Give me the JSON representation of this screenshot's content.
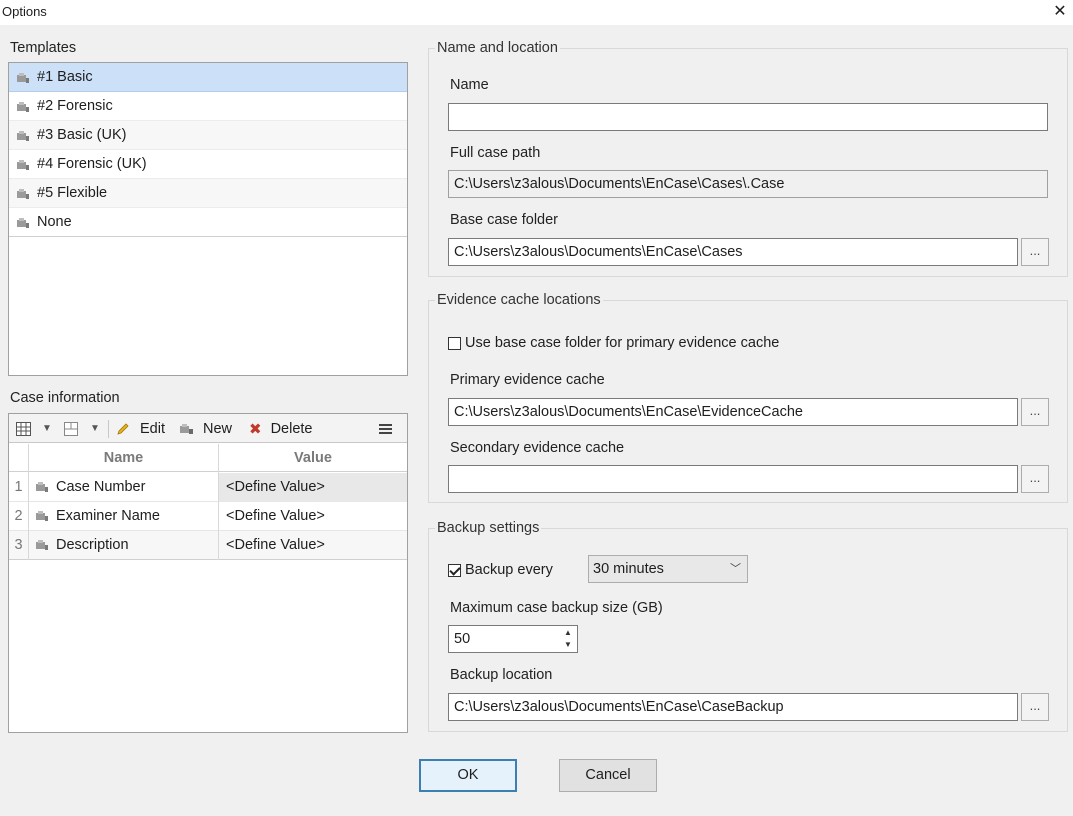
{
  "window": {
    "title": "Options",
    "close_icon": "✕"
  },
  "templates": {
    "label": "Templates",
    "items": [
      {
        "label": "#1 Basic",
        "selected": true
      },
      {
        "label": "#2 Forensic",
        "selected": false
      },
      {
        "label": "#3 Basic (UK)",
        "selected": false
      },
      {
        "label": "#4 Forensic (UK)",
        "selected": false
      },
      {
        "label": "#5 Flexible",
        "selected": false
      },
      {
        "label": "None",
        "selected": false
      }
    ]
  },
  "case_information": {
    "label": "Case information",
    "toolbar": {
      "edit_label": "Edit",
      "new_label": "New",
      "delete_label": "Delete"
    },
    "columns": [
      "Name",
      "Value"
    ],
    "rows": [
      {
        "num": "1",
        "name": "Case Number",
        "value": "<Define Value>"
      },
      {
        "num": "2",
        "name": "Examiner Name",
        "value": "<Define Value>"
      },
      {
        "num": "3",
        "name": "Description",
        "value": "<Define Value>"
      }
    ]
  },
  "name_and_location": {
    "title": "Name and location",
    "name_label": "Name",
    "name_value": "",
    "full_path_label": "Full case path",
    "full_path_value": "C:\\Users\\z3alous\\Documents\\EnCase\\Cases\\.Case",
    "base_folder_label": "Base case folder",
    "base_folder_value": "C:\\Users\\z3alous\\Documents\\EnCase\\Cases",
    "browse_label": "..."
  },
  "evidence_cache": {
    "title": "Evidence cache locations",
    "use_base_label": "Use base case folder for primary evidence cache",
    "use_base_checked": false,
    "primary_label": "Primary evidence cache",
    "primary_value": "C:\\Users\\z3alous\\Documents\\EnCase\\EvidenceCache",
    "secondary_label": "Secondary evidence cache",
    "secondary_value": "",
    "browse_label": "..."
  },
  "backup": {
    "title": "Backup settings",
    "backup_every_label": "Backup every",
    "backup_every_checked": true,
    "interval_value": "30 minutes",
    "max_size_label": "Maximum case backup size (GB)",
    "max_size_value": "50",
    "location_label": "Backup location",
    "location_value": "C:\\Users\\z3alous\\Documents\\EnCase\\CaseBackup",
    "browse_label": "..."
  },
  "buttons": {
    "ok_label": "OK",
    "cancel_label": "Cancel"
  },
  "colors": {
    "selection": "#cce0f7",
    "delete_icon": "#c0392b",
    "edit_icon": "#d4a017",
    "default_button_border": "#3c7fb1"
  }
}
